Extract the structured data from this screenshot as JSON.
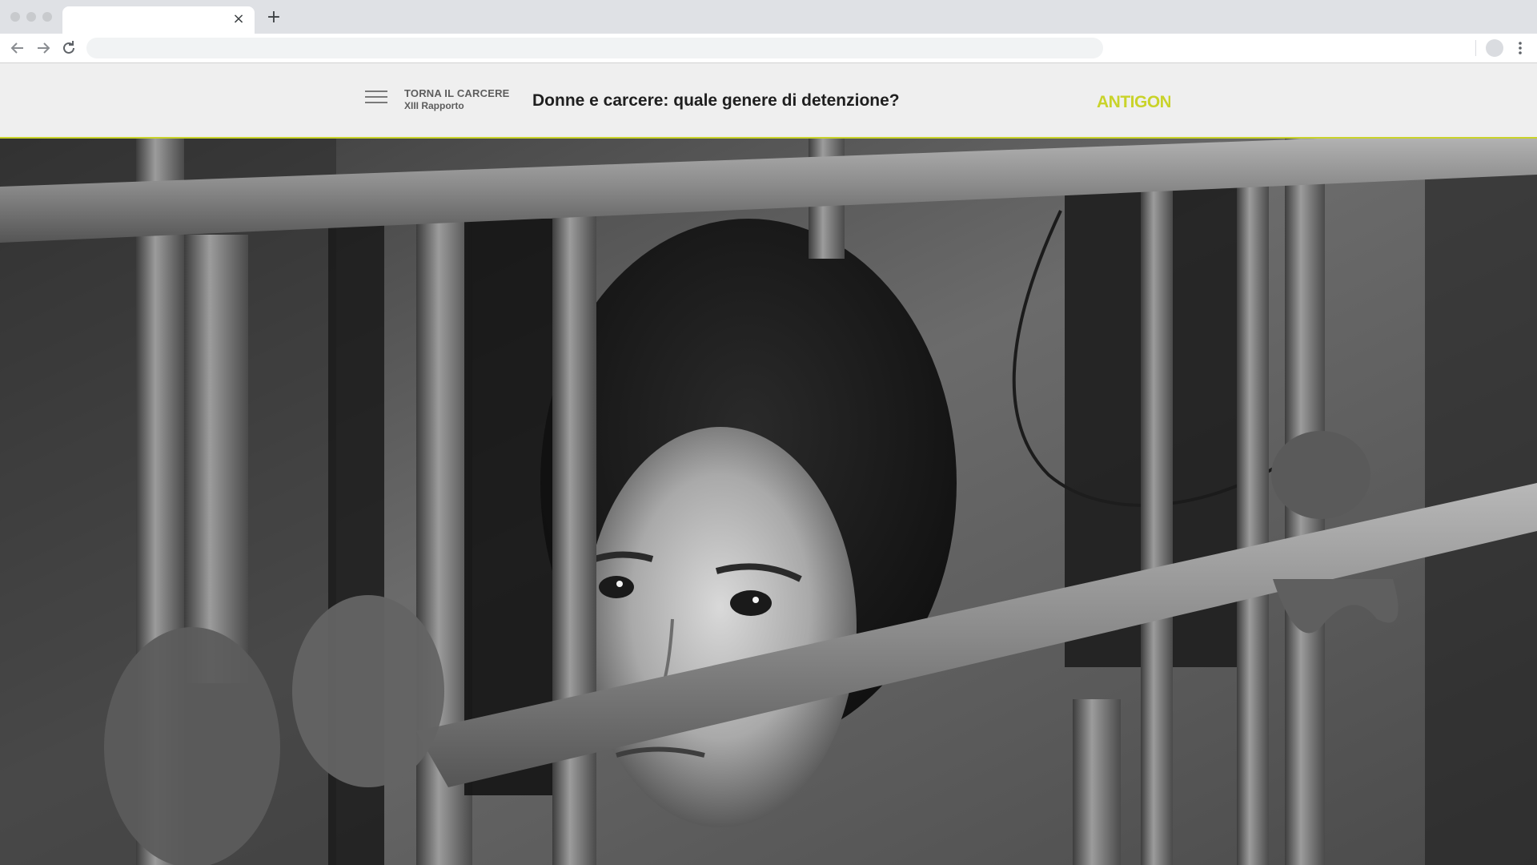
{
  "browser": {
    "tab": {
      "title": "",
      "close_glyph": "×"
    },
    "new_tab_glyph": "+",
    "address_bar": {
      "value": ""
    },
    "icons": [
      "back-arrow-icon",
      "forward-arrow-icon",
      "reload-icon",
      "profile-avatar-icon",
      "more-vert-icon"
    ]
  },
  "header": {
    "section": "TORNA IL CARCERE",
    "subsection": "XIII Rapporto",
    "title": "Donne e carcere: quale genere di detenzione?",
    "logo_text": "ANTIGONE",
    "accent_color": "#c9d32a",
    "menu_icon": "hamburger-menu-icon"
  },
  "hero": {
    "type": "black-and-white photo",
    "tone": "grayscale"
  }
}
